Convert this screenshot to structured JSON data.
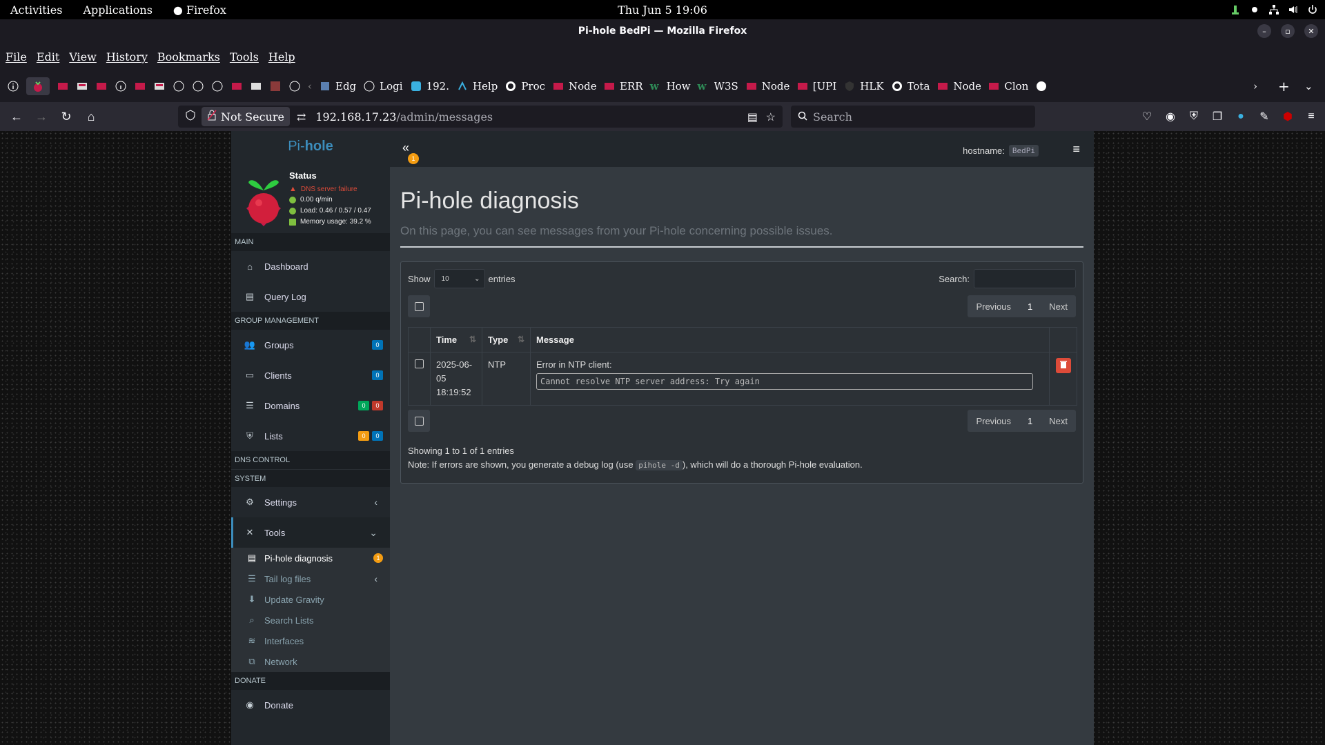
{
  "desktop": {
    "activities": "Activities",
    "applications": "Applications",
    "firefox": "Firefox",
    "clock": "Thu  Jun  5  19:06"
  },
  "window": {
    "title": "Pi-hole BedPi — Mozilla Firefox"
  },
  "menu": [
    "File",
    "Edit",
    "View",
    "History",
    "Bookmarks",
    "Tools",
    "Help"
  ],
  "bookmarks": [
    {
      "label": "Edg",
      "icon": "edge-icon"
    },
    {
      "label": "Logi",
      "icon": "info-icon"
    },
    {
      "label": "192.",
      "icon": "app-icon"
    },
    {
      "label": "Help",
      "icon": "help-icon"
    },
    {
      "label": "Proc",
      "icon": "github-icon"
    },
    {
      "label": "Node",
      "icon": "raspberry-icon"
    },
    {
      "label": "ERR",
      "icon": "raspberry-icon"
    },
    {
      "label": "How",
      "icon": "w-icon"
    },
    {
      "label": "W3S",
      "icon": "w-icon"
    },
    {
      "label": "Node",
      "icon": "raspberry-icon"
    },
    {
      "label": "[UPI",
      "icon": "raspberry-icon"
    },
    {
      "label": "HLK",
      "icon": "shield-icon"
    },
    {
      "label": "Tota",
      "icon": "github-icon"
    },
    {
      "label": "Node",
      "icon": "raspberry-icon"
    },
    {
      "label": "Clon",
      "icon": "raspberry-icon"
    }
  ],
  "urlbar": {
    "not_secure": "Not Secure",
    "host": "192.168.17.23",
    "path": "/admin/messages",
    "search_placeholder": "Search"
  },
  "sidebar": {
    "brand_light": "Pi-",
    "brand_bold": "hole",
    "status_title": "Status",
    "status": [
      {
        "text": "DNS server failure",
        "color": "#dd4b39"
      },
      {
        "text": "0.00 q/min",
        "color": "#7fbf3f"
      },
      {
        "text": "Load: 0.46 / 0.57 / 0.47",
        "color": "#7fbf3f"
      },
      {
        "text": "Memory usage: 39.2 %",
        "color": "#7fbf3f"
      }
    ],
    "headers": {
      "main": "MAIN",
      "group": "GROUP MANAGEMENT",
      "dns": "DNS CONTROL",
      "system": "SYSTEM",
      "donate": "DONATE"
    },
    "items": {
      "dashboard": "Dashboard",
      "querylog": "Query Log",
      "groups": "Groups",
      "clients": "Clients",
      "domains": "Domains",
      "lists": "Lists",
      "settings": "Settings",
      "tools": "Tools",
      "donate": "Donate"
    },
    "badges": {
      "groups": "0",
      "clients": "0",
      "domains_allow": "0",
      "domains_deny": "0",
      "lists_a": "0",
      "lists_b": "0",
      "diag": "1"
    },
    "tools_sub": {
      "diagnosis": "Pi-hole diagnosis",
      "tail": "Tail log files",
      "gravity": "Update Gravity",
      "search": "Search Lists",
      "interfaces": "Interfaces",
      "network": "Network"
    }
  },
  "topbar": {
    "hostname_label": "hostname:",
    "hostname_value": "BedPi",
    "collapse_badge": "1"
  },
  "page": {
    "title": "Pi-hole diagnosis",
    "subtitle": "On this page, you can see messages from your Pi-hole concerning possible issues."
  },
  "table": {
    "show": "Show",
    "entries_count": "10",
    "entries": "entries",
    "search_label": "Search:",
    "prev": "Previous",
    "page": "1",
    "next": "Next",
    "headers": {
      "time": "Time",
      "type": "Type",
      "message": "Message"
    },
    "rows": [
      {
        "time_date": "2025-06-05",
        "time_clock": "18:19:52",
        "type": "NTP",
        "message_title": "Error in NTP client:",
        "message_code": "Cannot resolve NTP server address: Try again"
      }
    ],
    "showing": "Showing 1 to 1 of 1 entries",
    "note_before": "Note: If errors are shown, you generate a debug log (use ",
    "note_code": "pihole -d",
    "note_after": "), which will do a thorough Pi-hole evaluation."
  }
}
